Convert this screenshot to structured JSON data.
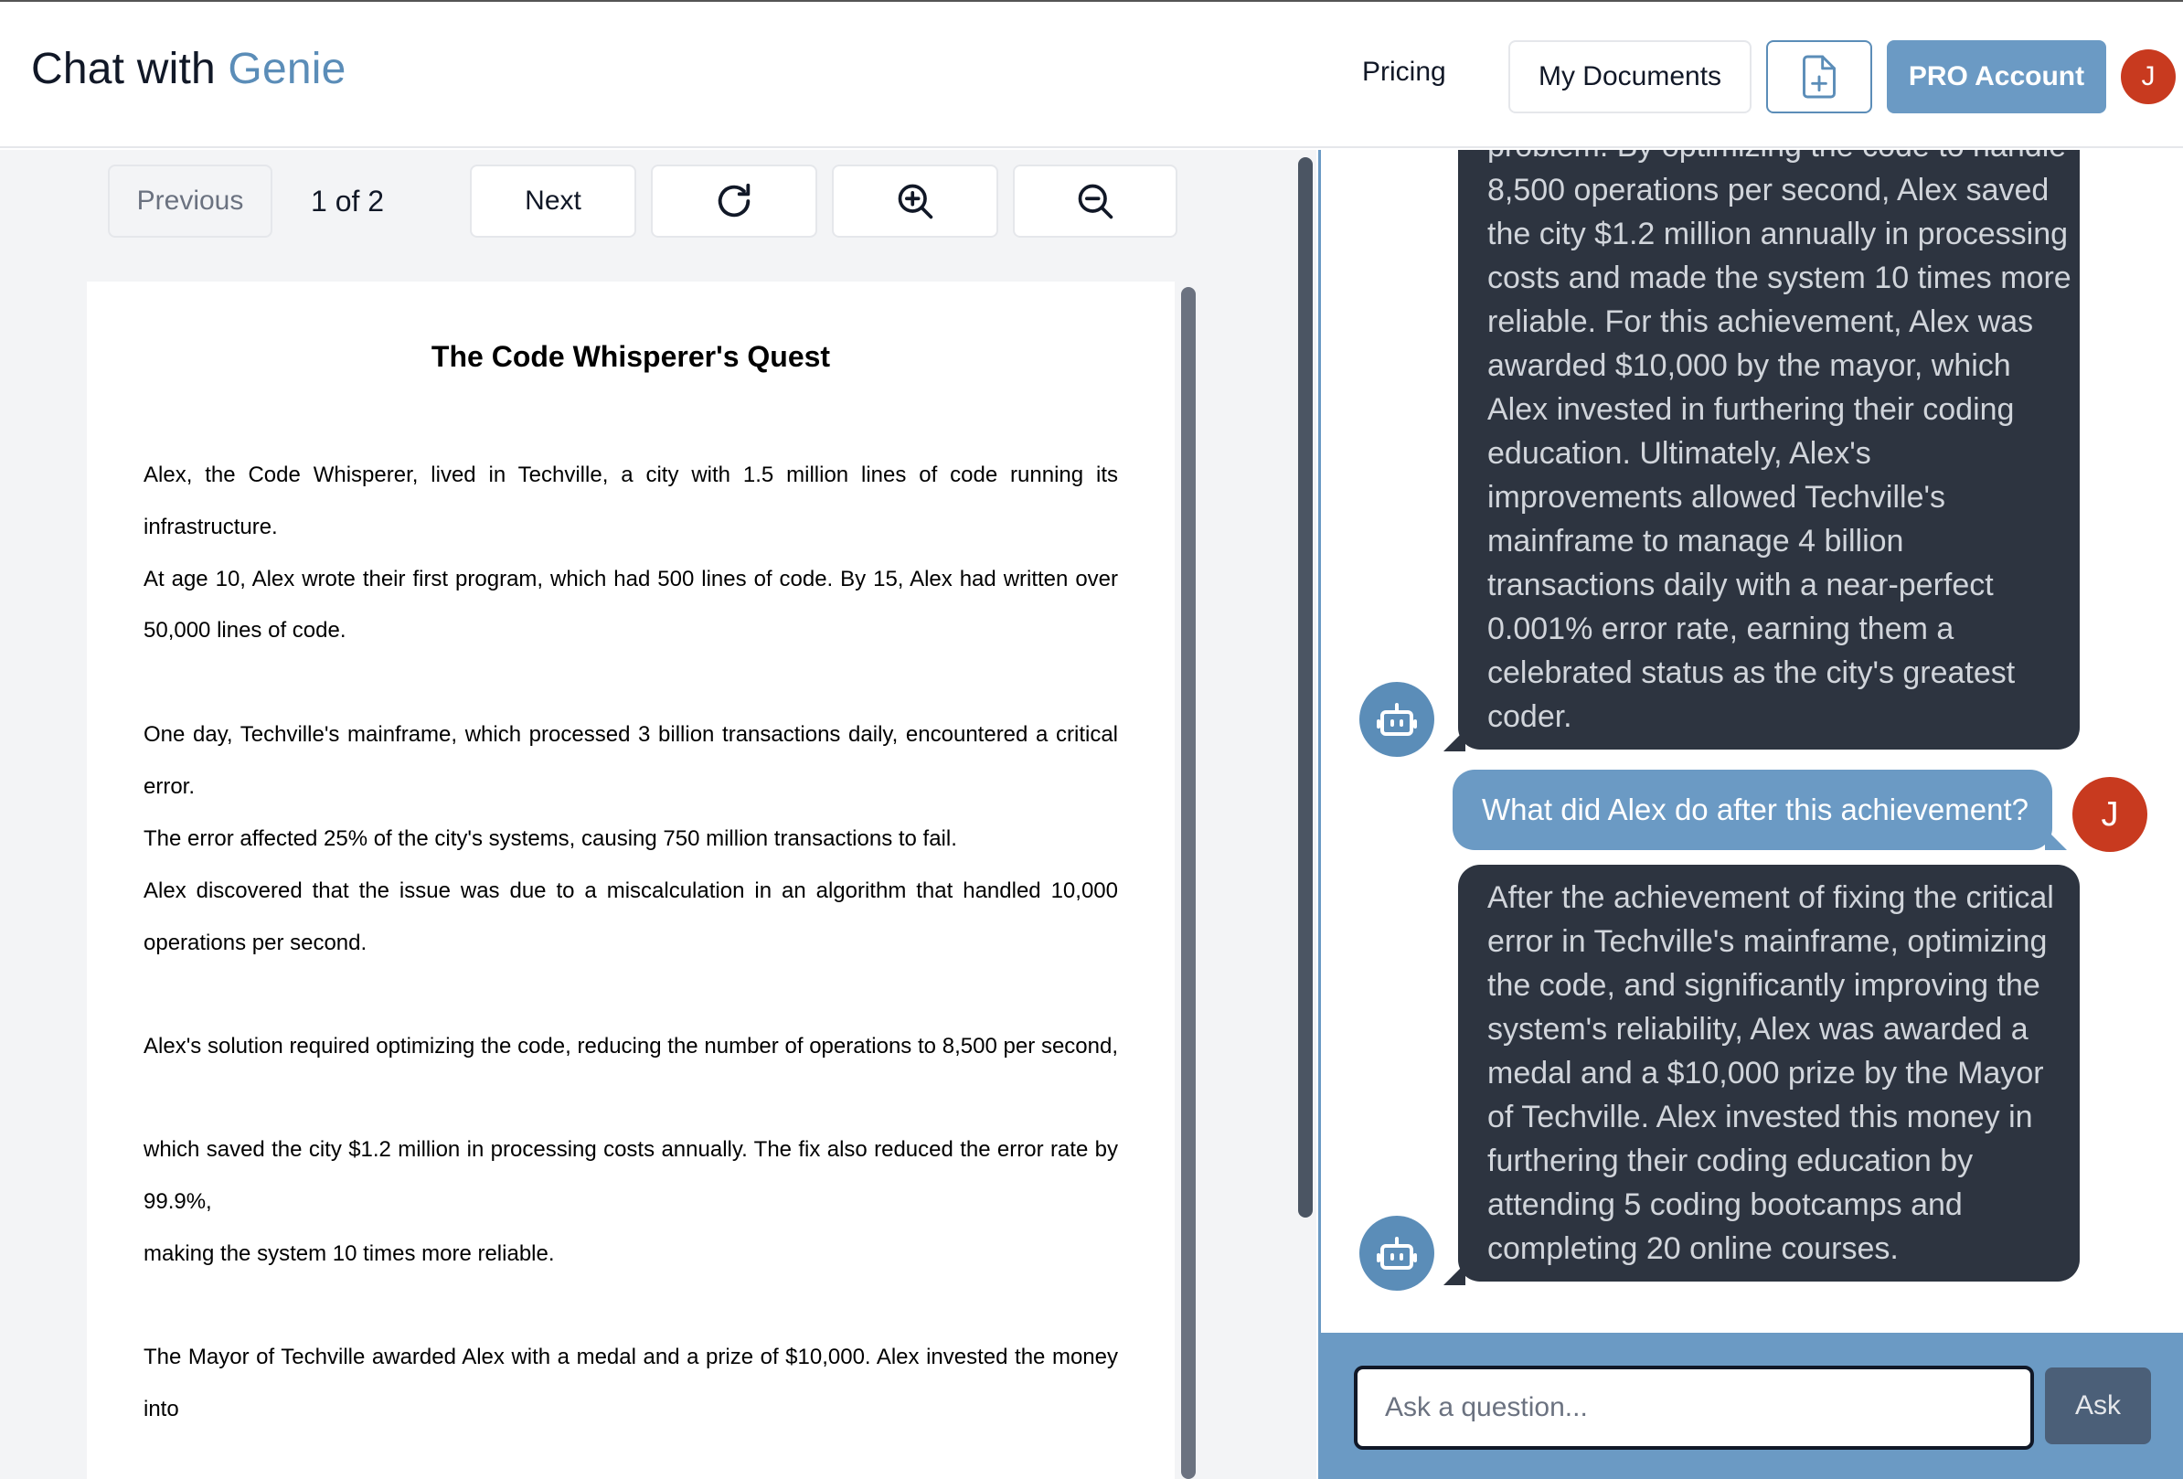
{
  "header": {
    "brand_prefix": "Chat with ",
    "brand_accent": "Genie",
    "pricing_label": "Pricing",
    "my_documents_label": "My Documents",
    "pro_label": "PRO Account",
    "avatar_initial": "J",
    "new_document_icon": "file-plus-icon"
  },
  "viewer": {
    "previous_label": "Previous",
    "page_indicator": "1 of 2",
    "next_label": "Next",
    "refresh_icon": "refresh-icon",
    "zoom_in_icon": "zoom-in-icon",
    "zoom_out_icon": "zoom-out-icon"
  },
  "document": {
    "title": "The Code Whisperer's Quest",
    "lines": [
      "Alex, the Code Whisperer, lived in Techville, a city with 1.5 million lines of code running its",
      "infrastructure.",
      "At age 10, Alex wrote their first program, which had 500 lines of code. By 15, Alex had written over",
      "50,000 lines of code.",
      "One day, Techville's mainframe, which processed 3 billion transactions daily, encountered a critical",
      "error.",
      "The error affected 25% of the city's systems, causing 750 million transactions to fail.",
      "Alex discovered that the issue was due to a miscalculation in an algorithm that handled 10,000",
      "operations per second.",
      "Alex's solution required optimizing the code, reducing the number of operations to 8,500 per second,",
      "which saved the city $1.2 million in processing costs annually. The fix also reduced the error rate by",
      "99.9%,",
      "making the system 10 times more reliable.",
      "The Mayor of Techville awarded Alex with a medal and a prize of $10,000. Alex invested the money",
      "into"
    ]
  },
  "chat": {
    "bot_message_1_lines": [
      "problem. By optimizing the code to handle",
      "8,500 operations per second, Alex saved",
      "the city $1.2 million annually in processing",
      "costs and made the system 10 times more",
      "reliable. For this achievement, Alex was",
      "awarded $10,000 by the mayor, which",
      "Alex invested in furthering their coding",
      "education. Ultimately, Alex's",
      "improvements allowed Techville's",
      "mainframe to manage 4 billion",
      "transactions daily with a near-perfect",
      "0.001% error rate, earning them a",
      "celebrated status as the city's greatest",
      "coder."
    ],
    "user_message": "What did Alex do after this achievement?",
    "user_avatar_initial": "J",
    "bot_message_2_lines": [
      "After the achievement of fixing the critical",
      "error in Techville's mainframe, optimizing",
      "the code, and significantly improving the",
      "system's reliability, Alex was awarded a",
      "medal and a $10,000 prize by the Mayor",
      "of Techville. Alex invested this money in",
      "furthering their coding education by",
      "attending 5 coding bootcamps and",
      "completing 20 online courses."
    ],
    "bot_avatar_icon": "robot-icon",
    "input_placeholder": "Ask a question...",
    "ask_label": "Ask"
  },
  "colors": {
    "accent": "#6b9ac4",
    "bot_bubble": "#2d3440",
    "avatar_user": "#c83a1f"
  }
}
